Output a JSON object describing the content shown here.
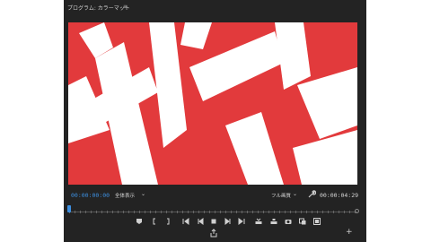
{
  "panel": {
    "title": "プログラム: カラーマット",
    "menu_icon": "hamburger-icon"
  },
  "video": {
    "background_color": "#e23a3c",
    "shape_color": "#ffffff",
    "content": "white shapes on red"
  },
  "status": {
    "timecode_current": "00:00:00:00",
    "fit_label": "全体表示",
    "resolution_label": "フル画質",
    "timecode_duration": "00:00:04:29",
    "accent_color": "#3d8fe0"
  },
  "controls": {
    "buttons": [
      "marker-icon",
      "mark-in-icon",
      "mark-out-icon",
      "go-to-in-icon",
      "step-back-icon",
      "stop-icon",
      "step-forward-icon",
      "go-to-out-icon",
      "insert-icon",
      "overwrite-icon",
      "camera-icon",
      "compare-icon",
      "proxy-icon",
      "export-icon",
      "add-button-icon"
    ]
  }
}
